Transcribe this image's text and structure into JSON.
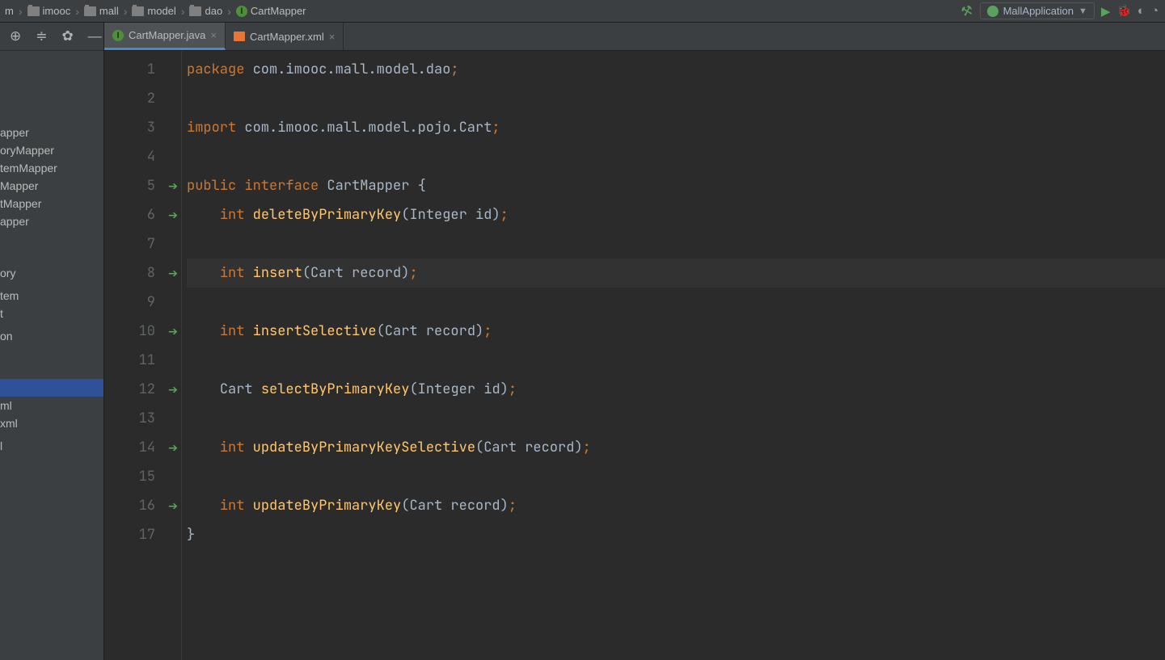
{
  "breadcrumbs": [
    "m",
    "imooc",
    "mall",
    "model",
    "dao"
  ],
  "breadcrumb_file": "CartMapper",
  "run_config": "MallApplication",
  "tabs": [
    {
      "label": "CartMapper.java",
      "type": "java",
      "active": true
    },
    {
      "label": "CartMapper.xml",
      "type": "xml",
      "active": false
    }
  ],
  "sidebar_items": [
    "apper",
    "oryMapper",
    "temMapper",
    "Mapper",
    "tMapper",
    "apper"
  ],
  "sidebar_items2": [
    "ory",
    "",
    "tem",
    "t",
    "",
    "on"
  ],
  "sidebar_items3": [
    "ml",
    "xml",
    "",
    "l"
  ],
  "gutter": {
    "count": 17,
    "arrows_at": [
      5,
      6,
      8,
      10,
      12,
      14,
      16
    ],
    "bulb_at": 8,
    "current_line": 8
  },
  "code": {
    "package": "com.imooc.mall.model.dao",
    "import": "com.imooc.mall.model.pojo.Cart",
    "interface_name": "CartMapper",
    "methods": [
      {
        "ret": "int",
        "name": "deleteByPrimaryKey",
        "params": "Integer id"
      },
      {
        "ret": "int",
        "name": "insert",
        "params": "Cart record"
      },
      {
        "ret": "int",
        "name": "insertSelective",
        "params": "Cart record"
      },
      {
        "ret": "Cart",
        "name": "selectByPrimaryKey",
        "params": "Integer id"
      },
      {
        "ret": "int",
        "name": "updateByPrimaryKeySelective",
        "params": "Cart record"
      },
      {
        "ret": "int",
        "name": "updateByPrimaryKey",
        "params": "Cart record"
      }
    ]
  }
}
